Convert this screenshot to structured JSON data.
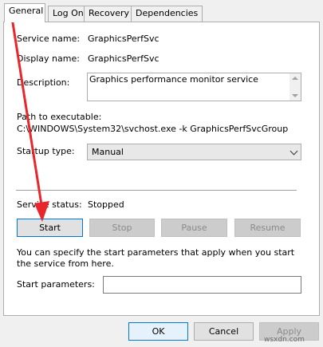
{
  "tabs": [
    {
      "label": "General",
      "active": true
    },
    {
      "label": "Log On",
      "active": false
    },
    {
      "label": "Recovery",
      "active": false
    },
    {
      "label": "Dependencies",
      "active": false
    }
  ],
  "fields": {
    "service_name_label": "Service name:",
    "service_name_value": "GraphicsPerfSvc",
    "display_name_label": "Display name:",
    "display_name_value": "GraphicsPerfSvc",
    "description_label": "Description:",
    "description_value": "Graphics performance monitor service",
    "path_label": "Path to executable:",
    "path_value": "C:\\WINDOWS\\System32\\svchost.exe -k GraphicsPerfSvcGroup",
    "startup_type_label": "Startup type:",
    "startup_type_value": "Manual",
    "service_status_label": "Service status:",
    "service_status_value": "Stopped"
  },
  "service_buttons": {
    "start": "Start",
    "stop": "Stop",
    "pause": "Pause",
    "resume": "Resume"
  },
  "help_text": "You can specify the start parameters that apply when you start the service from here.",
  "start_parameters_label": "Start parameters:",
  "start_parameters_value": "",
  "dialog_buttons": {
    "ok": "OK",
    "cancel": "Cancel",
    "apply": "Apply"
  },
  "annotation_color": "#e8262b",
  "watermark": "wsxdn.com"
}
